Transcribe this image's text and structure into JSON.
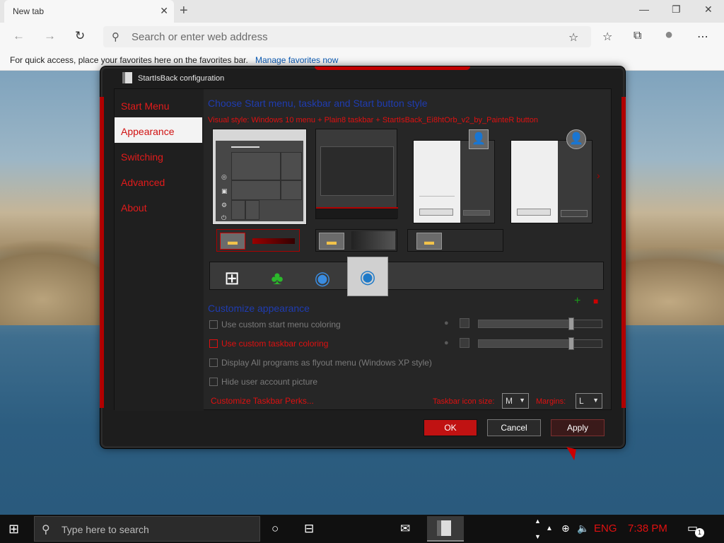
{
  "browser": {
    "tab_title": "New tab",
    "address_placeholder": "Search or enter web address",
    "favorites_message": "For quick access, place your favorites here on the favorites bar.",
    "favorites_link": "Manage favorites now"
  },
  "dialog": {
    "title": "StartIsBack configuration",
    "nav": {
      "items": [
        {
          "label": "Start Menu"
        },
        {
          "label": "Appearance"
        },
        {
          "label": "Switching"
        },
        {
          "label": "Advanced"
        },
        {
          "label": "About"
        }
      ],
      "selected": "Appearance"
    },
    "style_heading": "Choose Start menu, taskbar and Start button style",
    "visual_style": "Visual style:  Windows 10 menu + Plain8 taskbar + StartIsBack_Ei8htOrb_v2_by_PainteR button",
    "customize_heading": "Customize appearance",
    "options": [
      {
        "label": "Use custom start menu coloring",
        "checked": false,
        "enabled": false
      },
      {
        "label": "Use custom taskbar coloring",
        "checked": false,
        "enabled": true
      },
      {
        "label": "Display All programs as flyout menu (Windows XP style)",
        "checked": false,
        "enabled": false
      },
      {
        "label": "Hide user account picture",
        "checked": false,
        "enabled": false
      }
    ],
    "slider_levels": [
      0.75,
      0.75
    ],
    "perks_link": "Customize Taskbar Perks...",
    "icon_size_label": "Taskbar icon size:",
    "icon_size_value": "M",
    "margins_label": "Margins:",
    "margins_value": "L",
    "buttons": {
      "ok": "OK",
      "cancel": "Cancel",
      "apply": "Apply"
    }
  },
  "taskbar": {
    "search_placeholder": "Type here to search",
    "language": "ENG",
    "time": "7:38 PM",
    "notification_count": "1"
  },
  "colors": {
    "accent_red": "#e01010",
    "heading_blue": "#1f3cb0",
    "dialog_bg": "#1d1d1d"
  }
}
